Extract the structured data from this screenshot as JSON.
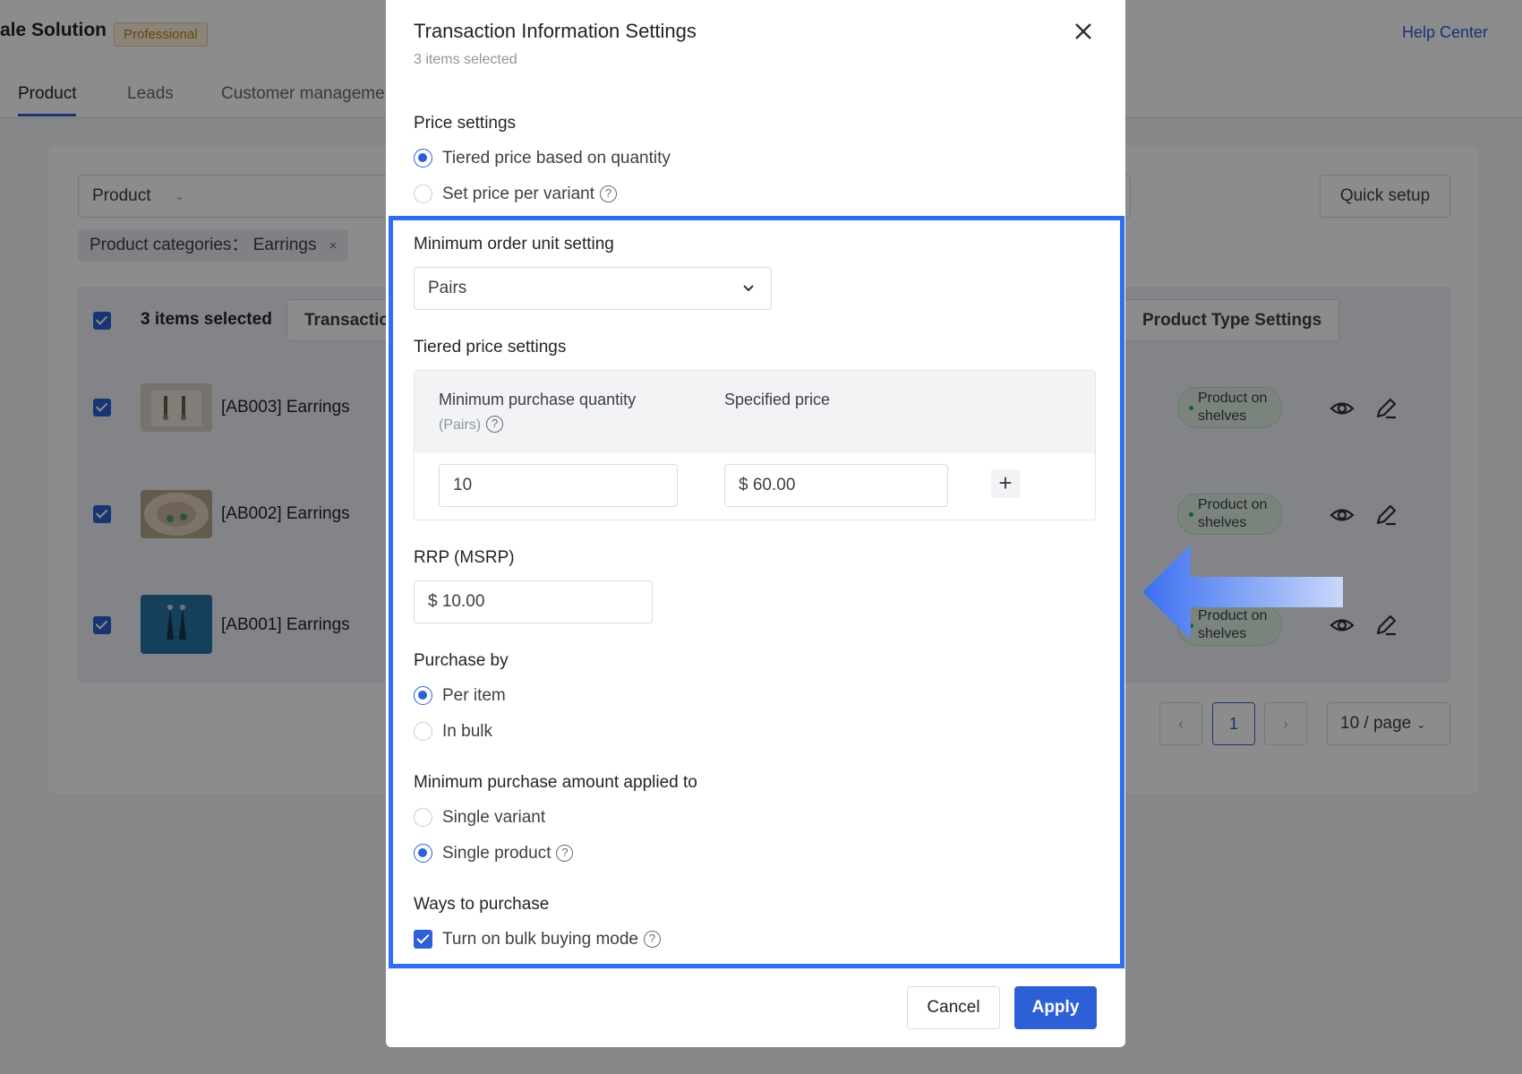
{
  "app": {
    "title": "ale Solution",
    "plan_badge": "Professional",
    "help_link": "Help Center",
    "nav_tabs": [
      {
        "label": "Product",
        "active": true
      },
      {
        "label": "Leads",
        "active": false
      },
      {
        "label": "Customer manageme",
        "active": false
      }
    ],
    "filter": {
      "field": "Product",
      "tag_label": "Product categories： Earrings",
      "tag_close": "×"
    },
    "quick_setup": "Quick setup",
    "bulk_bar": {
      "selected": "3 items selected",
      "transaction_button": "Transactio",
      "product_type_button": "Product Type Settings"
    },
    "rows": [
      {
        "name": "[AB003] Earrings",
        "status": "Product on shelves"
      },
      {
        "name": "[AB002] Earrings",
        "status": "Product on shelves"
      },
      {
        "name": "[AB001] Earrings",
        "status": "Product on shelves"
      }
    ],
    "pagination": {
      "prev": "‹",
      "current": "1",
      "next": "›",
      "page_size": "10 / page"
    }
  },
  "modal": {
    "title": "Transaction Information Settings",
    "subtitle": "3 items selected",
    "price_settings": {
      "label": "Price settings",
      "options": [
        {
          "label": "Tiered price based on quantity",
          "selected": true,
          "help": false
        },
        {
          "label": "Set price per variant",
          "selected": false,
          "help": true
        }
      ]
    },
    "min_order_unit": {
      "label": "Minimum order unit setting",
      "value": "Pairs"
    },
    "tiered_price": {
      "label": "Tiered price settings",
      "col_qty": "Minimum purchase quantity",
      "col_qty_unit": "(Pairs)",
      "col_price": "Specified price",
      "qty_value": "10",
      "price_value": "$ 60.00",
      "add_symbol": "+"
    },
    "rrp": {
      "label": "RRP (MSRP)",
      "value": "$ 10.00"
    },
    "purchase_by": {
      "label": "Purchase by",
      "options": [
        {
          "label": "Per item",
          "selected": true
        },
        {
          "label": "In bulk",
          "selected": false
        }
      ]
    },
    "min_amount": {
      "label": "Minimum purchase amount applied to",
      "options": [
        {
          "label": "Single variant",
          "selected": false,
          "help": false
        },
        {
          "label": "Single product",
          "selected": true,
          "help": true
        }
      ]
    },
    "ways": {
      "label": "Ways to purchase",
      "checkbox_label": "Turn on bulk buying mode",
      "checked": true
    },
    "help_symbol": "?",
    "cancel": "Cancel",
    "apply": "Apply"
  },
  "colors": {
    "accent": "#2d5fd6",
    "highlight": "#2f6ef0",
    "status_green": "#35a853",
    "badge_orange": "#c27a1a"
  }
}
